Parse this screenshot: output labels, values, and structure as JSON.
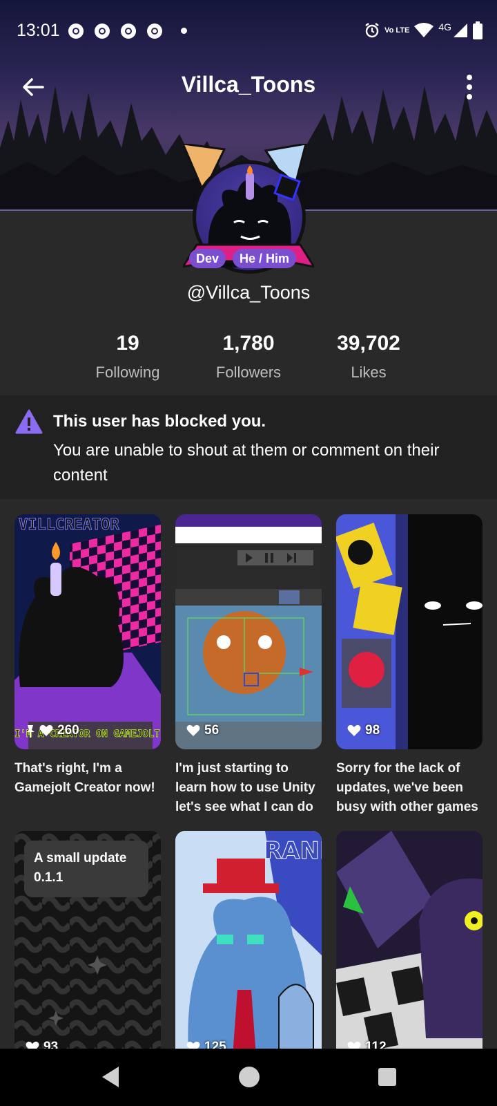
{
  "status_bar": {
    "time": "13:01",
    "network_label": "4G",
    "volte_label": "Vo LTE",
    "icons": [
      "chrome-icon",
      "chrome-icon",
      "chrome-icon",
      "chrome-icon",
      "notification-dot",
      "alarm-icon",
      "wifi-icon",
      "signal-icon",
      "battery-icon"
    ]
  },
  "header": {
    "title": "Villca_Toons",
    "back_icon": "arrow-left-icon",
    "menu_icon": "more-vertical-icon"
  },
  "profile": {
    "handle": "@Villca_Toons",
    "badges": [
      "Dev",
      "He / Him"
    ],
    "stats": [
      {
        "value": "19",
        "label": "Following"
      },
      {
        "value": "1,780",
        "label": "Followers"
      },
      {
        "value": "39,702",
        "label": "Likes"
      }
    ]
  },
  "block_notice": {
    "title": "This user has blocked you.",
    "message": "You are unable to shout at them or comment on their content",
    "icon": "warning-triangle-icon"
  },
  "posts": [
    {
      "likes": "260",
      "pinned": true,
      "caption": "That's right, I'm a Gamejolt Creator now!",
      "banner_top": "VILLCREATOR",
      "banner_bottom": "I'M A CREATOR ON GAMEJOLT NOW"
    },
    {
      "likes": "56",
      "pinned": false,
      "caption": "I'm just starting to learn how to use Unity let's see what I can do"
    },
    {
      "likes": "98",
      "pinned": false,
      "caption": "Sorry for the lack of updates, we've been busy with other games"
    },
    {
      "likes": "93",
      "pinned": false,
      "caption": "",
      "overlay_text": "A small update 0.1.1"
    },
    {
      "likes": "125",
      "pinned": false,
      "caption": "",
      "banner_top": "RAND"
    },
    {
      "likes": "112",
      "pinned": false,
      "caption": ""
    }
  ],
  "colors": {
    "background": "#292929",
    "accent_purple": "#7b4ed0",
    "warning": "#8a6cf0"
  }
}
